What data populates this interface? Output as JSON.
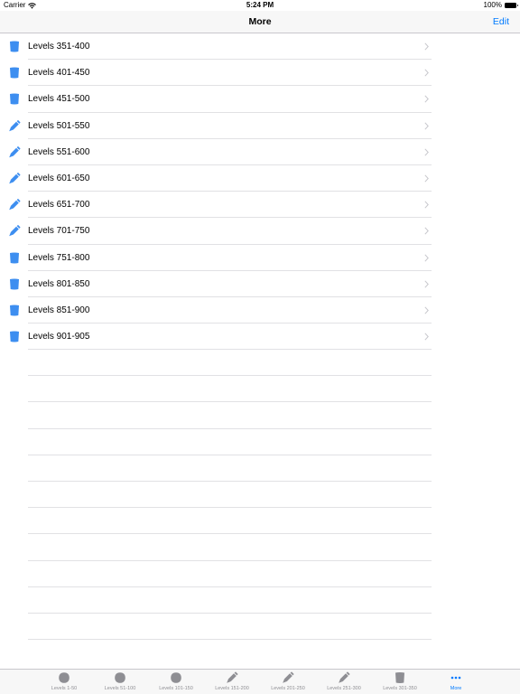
{
  "status_bar": {
    "carrier": "Carrier",
    "time": "5:24 PM",
    "battery": "100%"
  },
  "nav": {
    "title": "More",
    "edit_label": "Edit"
  },
  "list_items": [
    {
      "label": "Levels 351-400",
      "icon": "cup-icon"
    },
    {
      "label": "Levels 401-450",
      "icon": "cup-icon"
    },
    {
      "label": "Levels 451-500",
      "icon": "cup-icon"
    },
    {
      "label": "Levels 501-550",
      "icon": "pencil-icon"
    },
    {
      "label": "Levels 551-600",
      "icon": "pencil-icon"
    },
    {
      "label": "Levels 601-650",
      "icon": "pencil-icon"
    },
    {
      "label": "Levels 651-700",
      "icon": "pencil-icon"
    },
    {
      "label": "Levels 701-750",
      "icon": "pencil-icon"
    },
    {
      "label": "Levels 751-800",
      "icon": "cup-icon"
    },
    {
      "label": "Levels 801-850",
      "icon": "cup-icon"
    },
    {
      "label": "Levels 851-900",
      "icon": "cup-icon"
    },
    {
      "label": "Levels 901-905",
      "icon": "cup-icon"
    }
  ],
  "tabs": [
    {
      "label": "Levels 1-50",
      "icon": "circle-icon"
    },
    {
      "label": "Levels 51-100",
      "icon": "circle-icon"
    },
    {
      "label": "Levels 101-150",
      "icon": "circle-icon"
    },
    {
      "label": "Levels 151-200",
      "icon": "pencil-icon"
    },
    {
      "label": "Levels 201-250",
      "icon": "pencil-icon"
    },
    {
      "label": "Levels 251-300",
      "icon": "pencil-icon"
    },
    {
      "label": "Levels 301-350",
      "icon": "cup-icon"
    },
    {
      "label": "More",
      "icon": "more-icon",
      "active": true
    }
  ],
  "colors": {
    "accent": "#007aff",
    "list_icon": "#3d8ef0",
    "tab_icon": "#8e8e93"
  }
}
